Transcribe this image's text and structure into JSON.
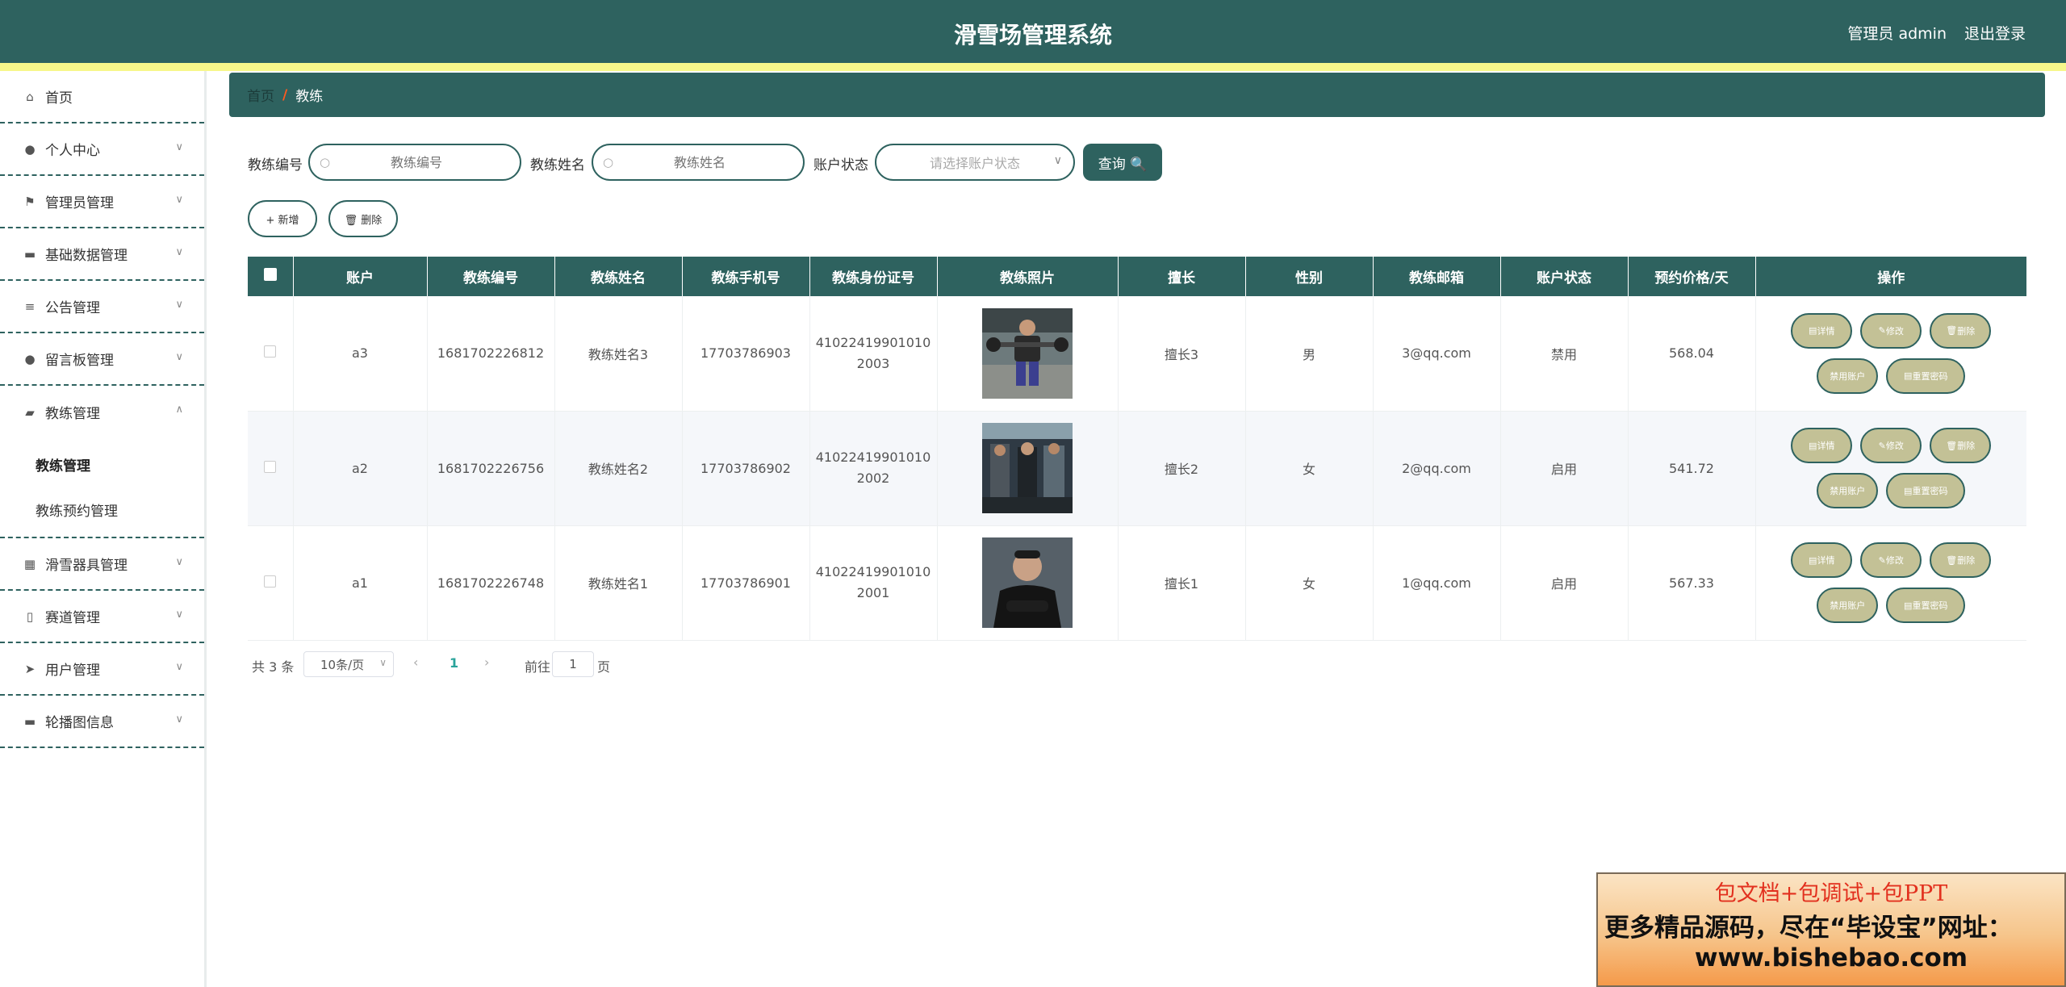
{
  "header": {
    "title": "滑雪场管理系统",
    "user_label": "管理员 admin",
    "logout_label": "退出登录",
    "accent_color": "#2e625f",
    "stripe_color": "#f7f78a"
  },
  "sidebar": {
    "items": [
      {
        "label": "首页",
        "icon": "home-icon"
      },
      {
        "label": "个人中心",
        "icon": "user-icon"
      },
      {
        "label": "管理员管理",
        "icon": "flag-icon"
      },
      {
        "label": "基础数据管理",
        "icon": "monitor-icon"
      },
      {
        "label": "公告管理",
        "icon": "list-icon"
      },
      {
        "label": "留言板管理",
        "icon": "pin-icon"
      },
      {
        "label": "教练管理",
        "icon": "briefcase-icon"
      },
      {
        "label": "滑雪器具管理",
        "icon": "grid-icon"
      },
      {
        "label": "赛道管理",
        "icon": "tube-icon"
      },
      {
        "label": "用户管理",
        "icon": "send-icon"
      },
      {
        "label": "轮播图信息",
        "icon": "monitor-icon"
      }
    ],
    "submenu": [
      {
        "label": "教练管理"
      },
      {
        "label": "教练预约管理"
      }
    ]
  },
  "breadcrumb": {
    "home": "首页",
    "separator": "/",
    "current": "教练"
  },
  "search": {
    "code_label": "教练编号",
    "code_placeholder": "教练编号",
    "name_label": "教练姓名",
    "name_placeholder": "教练姓名",
    "status_label": "账户状态",
    "status_placeholder": "请选择账户状态",
    "query_label": "查询 🔍"
  },
  "actions": {
    "add_label": "+ 新增",
    "delete_label": "🗑 删除"
  },
  "table": {
    "columns": [
      "账户",
      "教练编号",
      "教练姓名",
      "教练手机号",
      "教练身份证号",
      "教练照片",
      "擅长",
      "性别",
      "教练邮箱",
      "账户状态",
      "预约价格/天",
      "操作"
    ],
    "rows": [
      {
        "account": "a3",
        "code": "1681702226812",
        "name": "教练姓名3",
        "phone": "17703786903",
        "id_line1": "41022419901010",
        "id_line2": "2003",
        "skill": "擅长3",
        "gender": "男",
        "email": "3@qq.com",
        "status": "禁用",
        "price": "568.04"
      },
      {
        "account": "a2",
        "code": "1681702226756",
        "name": "教练姓名2",
        "phone": "17703786902",
        "id_line1": "41022419901010",
        "id_line2": "2002",
        "skill": "擅长2",
        "gender": "女",
        "email": "2@qq.com",
        "status": "启用",
        "price": "541.72"
      },
      {
        "account": "a1",
        "code": "1681702226748",
        "name": "教练姓名1",
        "phone": "17703786901",
        "id_line1": "41022419901010",
        "id_line2": "2001",
        "skill": "擅长1",
        "gender": "女",
        "email": "1@qq.com",
        "status": "启用",
        "price": "567.33"
      }
    ],
    "ops": {
      "detail": "详情",
      "edit": "修改",
      "delete": "删除",
      "disable": "禁用账户",
      "reset": "重置密码"
    }
  },
  "pagination": {
    "total": "共 3 条",
    "page_size": "10条/页",
    "prev": "‹",
    "current_page": "1",
    "next": "›",
    "goto_label": "前往",
    "goto_value": "1",
    "page_suffix": "页"
  },
  "promo": {
    "line1": "包文档+包调试+包PPT",
    "line2": "更多精品源码，尽在“毕设宝”网址：",
    "line3": "www.bishebao.com"
  }
}
